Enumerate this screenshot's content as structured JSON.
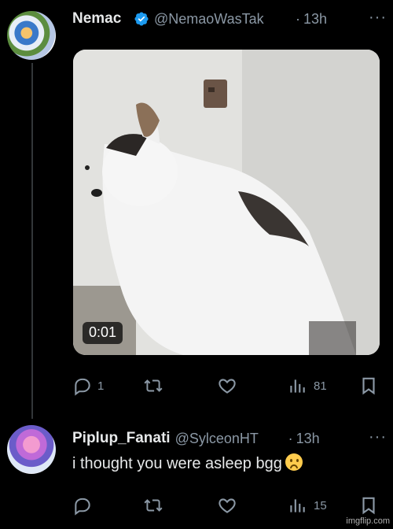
{
  "tweet1": {
    "display_name": "Nemac",
    "handle": "@NemaoWasTak",
    "separator": "·",
    "time": "13h",
    "more": "···",
    "video_timestamp": "0:01",
    "replies": "1",
    "views": "81"
  },
  "tweet2": {
    "display_name": "Piplup_Fanati",
    "handle": "@SylceonHT",
    "separator": "·",
    "time": "13h",
    "more": "···",
    "text": "i thought you were asleep bgg",
    "emoji": "frowning-face",
    "views": "15"
  },
  "colors": {
    "background": "#000000",
    "text": "#e7e9ea",
    "muted": "#8b98a5",
    "verified": "#1d9bf0",
    "thread_line": "#333639"
  },
  "watermark": "imgflip.com"
}
